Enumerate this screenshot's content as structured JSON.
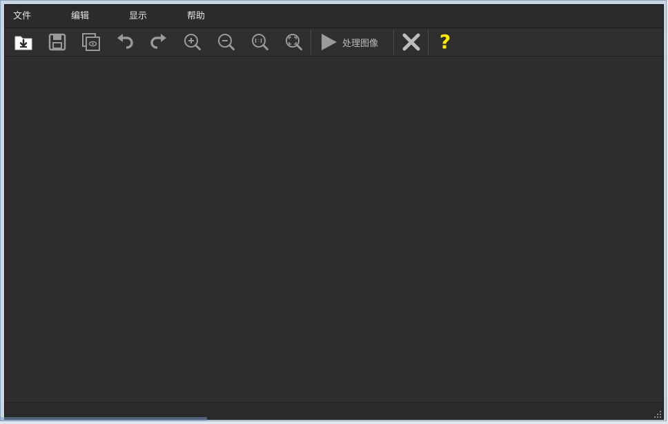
{
  "menu": [
    {
      "label": "文件"
    },
    {
      "label": "编辑"
    },
    {
      "label": "显示"
    },
    {
      "label": "帮助"
    }
  ],
  "toolbar": {
    "process_label": "处理图像",
    "help_label": "?",
    "icons": [
      "open-folder-icon",
      "save-icon",
      "preview-icon",
      "undo-icon",
      "redo-icon",
      "zoom-in-icon",
      "zoom-out-icon",
      "zoom-actual-icon",
      "zoom-fit-icon",
      "play-icon",
      "close-icon",
      "help-icon"
    ]
  },
  "colors": {
    "background": "#2b2b2b",
    "canvas": "#2e2e2e",
    "menu_text": "#e6e6e6",
    "icon_gray": "#9a9a9a",
    "help_yellow": "#ffee00"
  }
}
